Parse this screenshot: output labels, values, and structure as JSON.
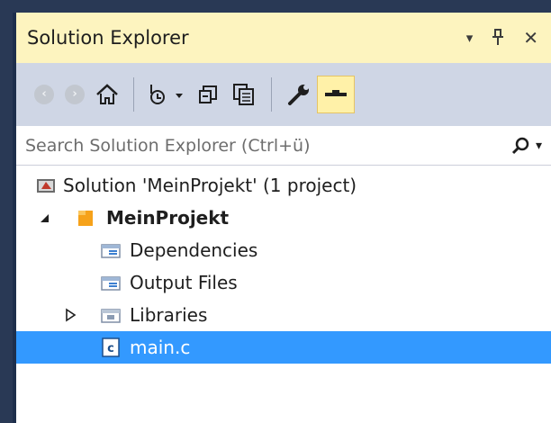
{
  "window": {
    "title": "Solution Explorer",
    "controls": {
      "dropdown": "▾",
      "pin": "⊥",
      "close": "✕"
    }
  },
  "toolbar": {
    "items": [
      {
        "name": "back-icon"
      },
      {
        "name": "forward-icon"
      },
      {
        "name": "home-icon"
      },
      {
        "name": "pending-changes-filter-icon"
      },
      {
        "name": "collapse-all-icon"
      },
      {
        "name": "show-all-files-icon"
      },
      {
        "name": "properties-wrench-icon"
      },
      {
        "name": "preview-selected-icon",
        "active": true
      }
    ]
  },
  "search": {
    "placeholder": "Search Solution Explorer (Ctrl+ü)"
  },
  "tree": {
    "items": [
      {
        "label": "Solution 'MeinProjekt' (1 project)",
        "level": 0,
        "icon": "solution-icon"
      },
      {
        "label": "MeinProjekt",
        "level": 1,
        "icon": "project-icon",
        "bold": true,
        "expanded": true
      },
      {
        "label": "Dependencies",
        "level": 2,
        "icon": "folder-icon"
      },
      {
        "label": "Output Files",
        "level": 2,
        "icon": "folder-icon"
      },
      {
        "label": "Libraries",
        "level": 2,
        "icon": "folder-icon",
        "collapsed": true
      },
      {
        "label": "main.c",
        "level": 2,
        "icon": "c-file-icon",
        "selected": true
      }
    ]
  },
  "colors": {
    "accent": "#3399ff",
    "titlebar": "#fdf4bf",
    "toolbar": "#cfd6e5",
    "frame": "#293955"
  }
}
